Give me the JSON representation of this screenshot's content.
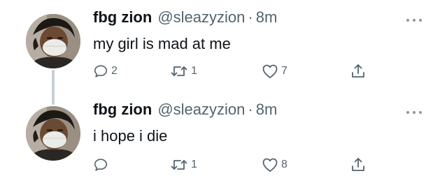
{
  "tweets": [
    {
      "author_name": "fbg zion",
      "handle": "@sleazyzion",
      "separator": "·",
      "time": "8m",
      "text": "my girl is mad at me",
      "reply_count": "2",
      "retweet_count": "1",
      "like_count": "7",
      "icons": [
        "comment-icon",
        "retweet-icon",
        "heart-icon",
        "share-icon",
        "more-icon"
      ]
    },
    {
      "author_name": "fbg zion",
      "handle": "@sleazyzion",
      "separator": "·",
      "time": "8m",
      "text": "i hope i die",
      "reply_count": "",
      "retweet_count": "1",
      "like_count": "8",
      "icons": [
        "comment-icon",
        "retweet-icon",
        "heart-icon",
        "share-icon",
        "more-icon"
      ]
    }
  ],
  "colors": {
    "text": "#0f1419",
    "secondary": "#53646f",
    "thread_line": "#c4cfd6",
    "background": "#ffffff"
  }
}
